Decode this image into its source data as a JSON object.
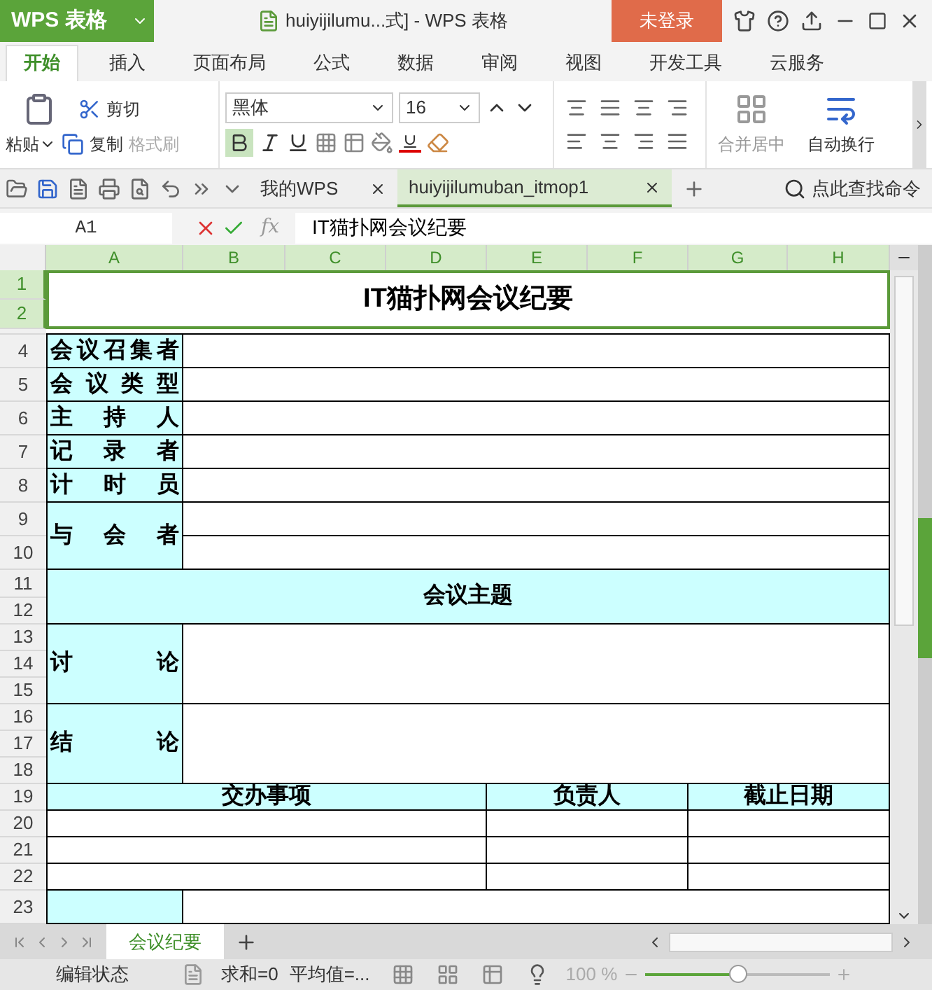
{
  "title_bar": {
    "app_menu": "WPS 表格",
    "document_title": "huiyijilumu...式] - WPS 表格",
    "login_button": "未登录"
  },
  "menu_tabs": [
    {
      "label": "开始",
      "selected": true
    },
    {
      "label": "插入",
      "selected": false
    },
    {
      "label": "页面布局",
      "selected": false
    },
    {
      "label": "公式",
      "selected": false
    },
    {
      "label": "数据",
      "selected": false
    },
    {
      "label": "审阅",
      "selected": false
    },
    {
      "label": "视图",
      "selected": false
    },
    {
      "label": "开发工具",
      "selected": false
    },
    {
      "label": "云服务",
      "selected": false
    }
  ],
  "ribbon": {
    "paste": "粘贴",
    "cut": "剪切",
    "copy": "复制",
    "format_painter": {
      "label": "格式刷",
      "disabled": true
    },
    "font_name": "黑体",
    "font_size": "16",
    "bold": {
      "selected": true
    },
    "merge": {
      "label": "合并居中",
      "disabled": true
    },
    "wrap_text": "自动换行"
  },
  "doc_tabs": [
    {
      "label": "我的WPS",
      "selected": false
    },
    {
      "label": "huiyijilumuban_itmop1",
      "selected": true
    }
  ],
  "command_search": "点此查找命令",
  "formula_bar": {
    "cell_ref": "A1",
    "fx": "fx",
    "content": "IT猫扑网会议纪要"
  },
  "columns": [
    {
      "label": "A",
      "selected": true
    },
    {
      "label": "B",
      "selected": true
    },
    {
      "label": "C",
      "selected": true
    },
    {
      "label": "D",
      "selected": true
    },
    {
      "label": "E",
      "selected": true
    },
    {
      "label": "F",
      "selected": true
    },
    {
      "label": "G",
      "selected": true
    },
    {
      "label": "H",
      "selected": true
    }
  ],
  "rows": [
    {
      "label": "1",
      "selected": true
    },
    {
      "label": "2",
      "selected": true
    },
    {
      "selected": false
    },
    {
      "label": "4",
      "selected": false
    },
    {
      "label": "5",
      "selected": false
    },
    {
      "label": "6",
      "selected": false
    },
    {
      "label": "7",
      "selected": false
    },
    {
      "label": "8",
      "selected": false
    },
    {
      "label": "9",
      "selected": false
    },
    {
      "label": "10",
      "selected": false
    },
    {
      "label": "11",
      "selected": false
    },
    {
      "label": "12",
      "selected": false
    },
    {
      "label": "13",
      "selected": false
    },
    {
      "label": "14",
      "selected": false
    },
    {
      "label": "15",
      "selected": false
    },
    {
      "label": "16",
      "selected": false
    },
    {
      "label": "17",
      "selected": false
    },
    {
      "label": "18",
      "selected": false
    },
    {
      "label": "19",
      "selected": false
    },
    {
      "label": "20",
      "selected": false
    },
    {
      "label": "21",
      "selected": false
    },
    {
      "label": "22",
      "selected": false
    },
    {
      "label": "23",
      "selected": false
    }
  ],
  "sheet": {
    "title": {
      "text": "IT猫扑网会议纪要",
      "selected": true
    },
    "fields": [
      {
        "label": "会议召集者",
        "kind": "single"
      },
      {
        "label": "会议类型",
        "kind": "single"
      },
      {
        "label": "主持人",
        "kind": "single"
      },
      {
        "label": "记录者",
        "kind": "single"
      },
      {
        "label": "计时员",
        "kind": "single"
      },
      {
        "label": "与会者",
        "kind": "double"
      }
    ],
    "topic_heading": "会议主题",
    "notes": [
      {
        "label": "讨论"
      },
      {
        "label": "结论"
      }
    ],
    "action_columns": [
      "交办事项",
      "负责人",
      "截止日期"
    ]
  },
  "sheet_tabs": [
    {
      "label": "会议纪要",
      "selected": true
    }
  ],
  "status_bar": {
    "mode": "编辑状态",
    "sum": "求和=0",
    "average": "平均值=...",
    "zoom": "100 %",
    "zoom_slider": {
      "level": 0.5
    }
  }
}
